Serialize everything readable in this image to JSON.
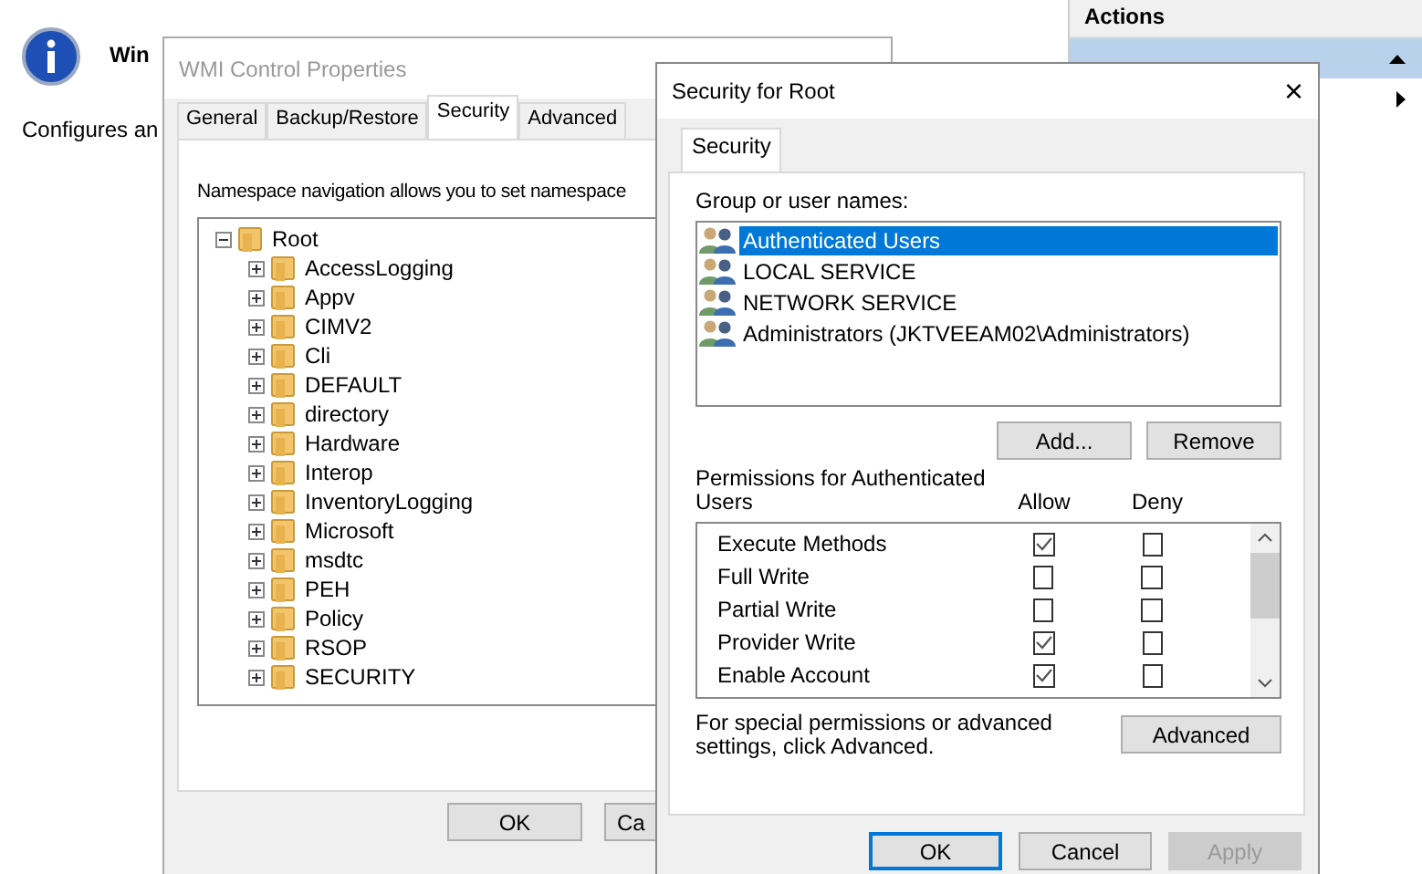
{
  "background": {
    "title": "Win",
    "description": "Configures an"
  },
  "actions_pane": {
    "header": "Actions",
    "items": [
      {
        "selected": true
      }
    ]
  },
  "properties_window": {
    "title": "WMI Control Properties",
    "active": false,
    "tabs": [
      {
        "label": "General",
        "selected": false
      },
      {
        "label": "Backup/Restore",
        "selected": false
      },
      {
        "label": "Security",
        "selected": true
      },
      {
        "label": "Advanced",
        "selected": false
      }
    ],
    "intro": "Namespace navigation allows you to set namespace",
    "tree": [
      {
        "label": "Root",
        "expanded": true,
        "children": [
          {
            "label": "AccessLogging",
            "expanded": false
          },
          {
            "label": "Appv",
            "expanded": false
          },
          {
            "label": "CIMV2",
            "expanded": false
          },
          {
            "label": "Cli",
            "expanded": false
          },
          {
            "label": "DEFAULT",
            "expanded": false
          },
          {
            "label": "directory",
            "expanded": false
          },
          {
            "label": "Hardware",
            "expanded": false
          },
          {
            "label": "Interop",
            "expanded": false
          },
          {
            "label": "InventoryLogging",
            "expanded": false
          },
          {
            "label": "Microsoft",
            "expanded": false
          },
          {
            "label": "msdtc",
            "expanded": false
          },
          {
            "label": "PEH",
            "expanded": false
          },
          {
            "label": "Policy",
            "expanded": false
          },
          {
            "label": "RSOP",
            "expanded": false
          },
          {
            "label": "SECURITY",
            "expanded": false
          }
        ]
      }
    ],
    "buttons": [
      "OK",
      "Ca"
    ]
  },
  "security_dialog": {
    "title": "Security for Root",
    "close": "×",
    "tabs": [
      {
        "label": "Security",
        "selected": true
      }
    ],
    "users_label": "Group or user names:",
    "users": [
      {
        "name": "Authenticated Users",
        "selected": true
      },
      {
        "name": "LOCAL SERVICE",
        "selected": false
      },
      {
        "name": "NETWORK SERVICE",
        "selected": false
      },
      {
        "name": "Administrators (JKTVEEAM02\\Administrators)",
        "selected": false
      }
    ],
    "user_buttons": [
      "Add...",
      "Remove"
    ],
    "permissions_label": "Permissions for Authenticated Users",
    "allow_header": "Allow",
    "deny_header": "Deny",
    "permissions": [
      {
        "name": "Execute Methods",
        "allow": true,
        "deny": false
      },
      {
        "name": "Full Write",
        "allow": false,
        "deny": false
      },
      {
        "name": "Partial Write",
        "allow": false,
        "deny": false
      },
      {
        "name": "Provider Write",
        "allow": true,
        "deny": false
      },
      {
        "name": "Enable Account",
        "allow": true,
        "deny": false
      }
    ],
    "advanced_note": "For special permissions or advanced settings, click Advanced.",
    "advanced_button": "Advanced",
    "buttons": [
      {
        "label": "OK",
        "kind": "default",
        "disabled": false
      },
      {
        "label": "Cancel",
        "kind": "normal",
        "disabled": false
      },
      {
        "label": "Apply",
        "kind": "normal",
        "disabled": true
      }
    ]
  }
}
